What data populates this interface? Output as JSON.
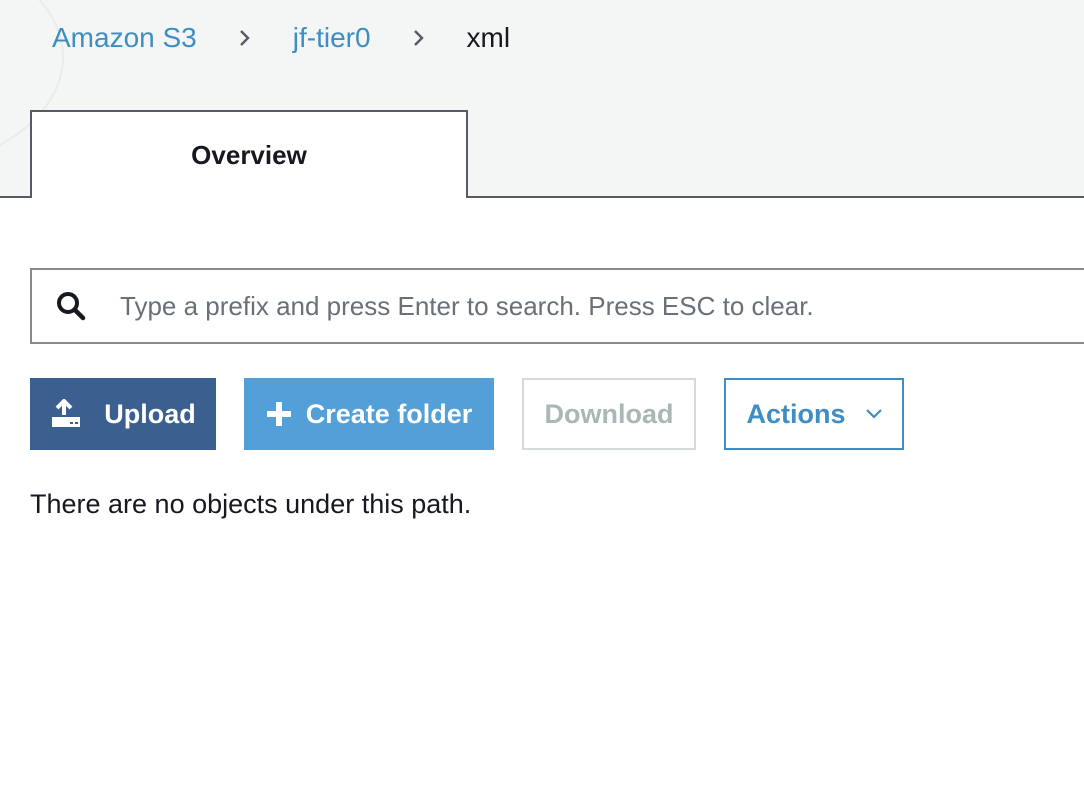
{
  "breadcrumb": {
    "items": [
      {
        "label": "Amazon S3"
      },
      {
        "label": "jf-tier0"
      },
      {
        "label": "xml"
      }
    ]
  },
  "tabs": [
    {
      "label": "Overview",
      "active": true
    }
  ],
  "search": {
    "value": "",
    "placeholder": "Type a prefix and press Enter to search. Press ESC to clear."
  },
  "toolbar": {
    "upload_label": "Upload",
    "create_folder_label": "Create folder",
    "download_label": "Download",
    "actions_label": "Actions"
  },
  "icons": {
    "search": "search-icon",
    "upload": "upload-icon",
    "create_folder": "plus-icon",
    "actions": "chevron-down-icon",
    "breadcrumb_separator": "chevron-right-icon"
  },
  "colors": {
    "link": "#3e8ec4",
    "upload_button": "#3b5f8e",
    "create_folder_button": "#539fd7",
    "disabled_text": "#aab7b8",
    "header_background": "#f4f5f5"
  },
  "empty_state": {
    "message": "There are no objects under this path."
  }
}
